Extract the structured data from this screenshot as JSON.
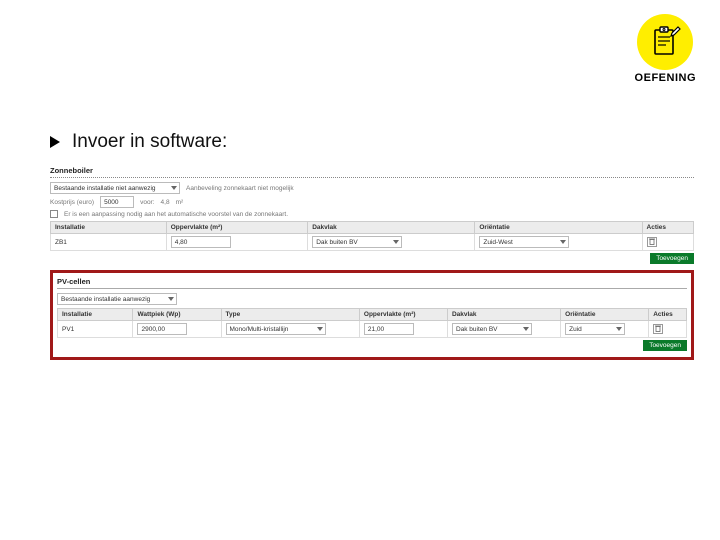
{
  "badge": {
    "label": "OEFENING"
  },
  "bullet": {
    "text": "Invoer in software:"
  },
  "zonneboiler": {
    "title": "Zonneboiler",
    "existing_select": "Bestaande installatie niet aanwezig",
    "sunmap_msg": "Aanbeveling zonnekaart niet mogelijk",
    "kostprijs_label": "Kostprijs (euro)",
    "kostprijs_value": "5000",
    "voor_label": "voor:",
    "voor_value": "4,8",
    "unit": "m²",
    "checkbox_label": "Er is een aanpassing nodig aan het automatische voorstel van de zonnekaart.",
    "headers": [
      "Installatie",
      "Oppervlakte (m²)",
      "Dakvlak",
      "Oriëntatie",
      "Acties"
    ],
    "row": {
      "installatie": "ZB1",
      "oppervlakte": "4,80",
      "dakvlak": "Dak buiten BV",
      "orientatie": "Zuid-West"
    },
    "add_button": "Toevoegen"
  },
  "pv": {
    "title": "PV-cellen",
    "existing_select": "Bestaande installatie aanwezig",
    "headers": [
      "Installatie",
      "Wattpiek (Wp)",
      "Type",
      "Oppervlakte (m²)",
      "Dakvlak",
      "Oriëntatie",
      "Acties"
    ],
    "row": {
      "installatie": "PV1",
      "wattpiek": "2900,00",
      "type": "Mono/Multi-kristallijn",
      "oppervlakte": "21,00",
      "dakvlak": "Dak buiten BV",
      "orientatie": "Zuid"
    },
    "add_button": "Toevoegen"
  }
}
